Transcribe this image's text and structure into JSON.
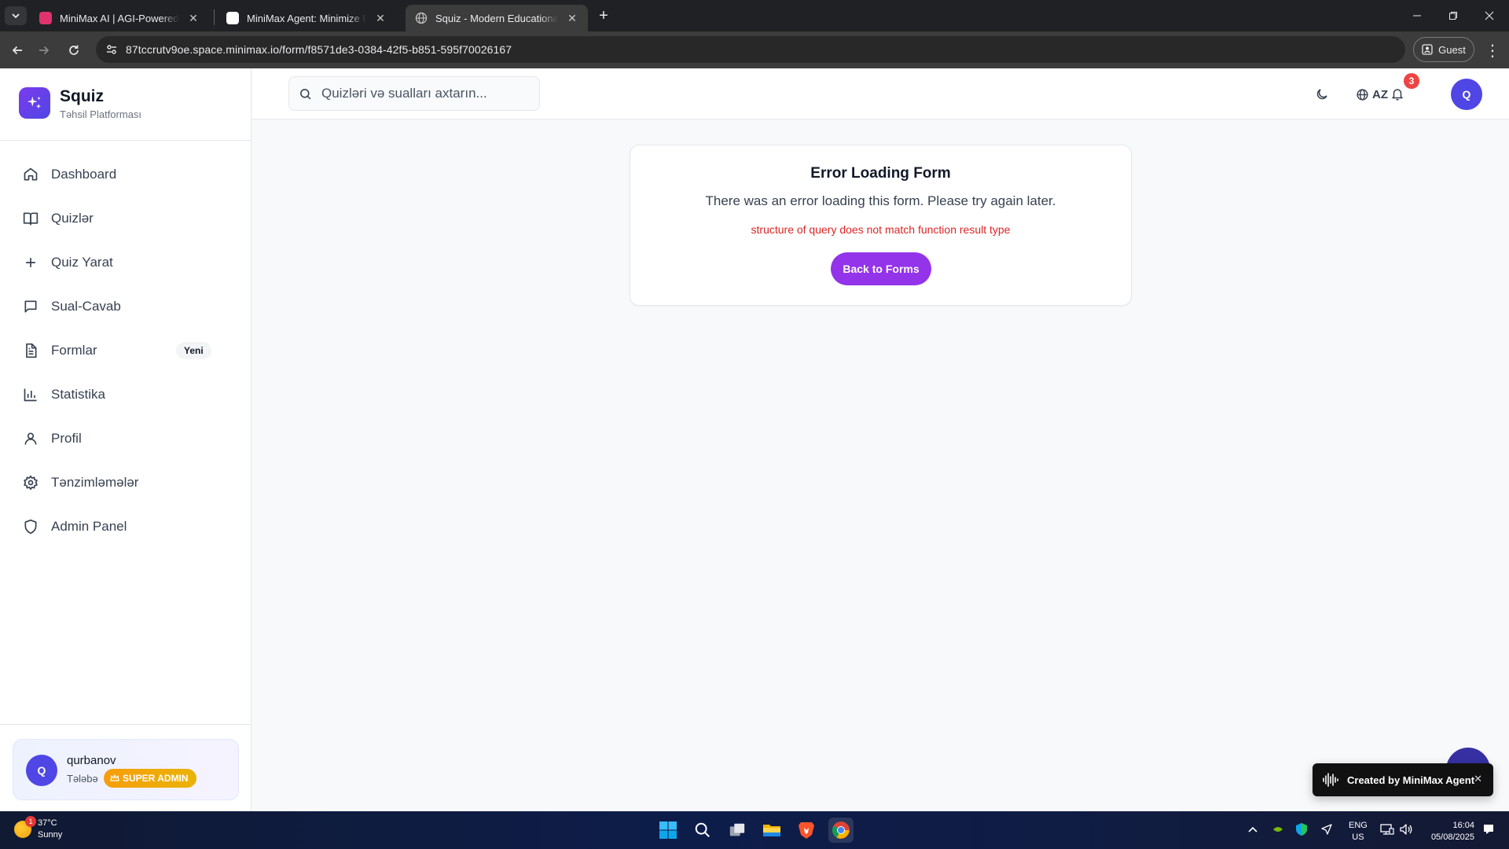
{
  "browser": {
    "tabs": [
      {
        "title": "MiniMax AI | AGI-Powered Fo",
        "active": false
      },
      {
        "title": "MiniMax Agent: Minimize Effort",
        "active": false
      },
      {
        "title": "Squiz - Modern Educational Pla",
        "active": true
      }
    ],
    "url": "87tccrutv9oe.space.minimax.io/form/f8571de3-0384-42f5-b851-595f70026167",
    "profile_label": "Guest"
  },
  "app": {
    "brand": {
      "name": "Squiz",
      "subtitle": "Təhsil Platforması"
    },
    "nav": [
      {
        "label": "Dashboard",
        "icon": "home-icon"
      },
      {
        "label": "Quizlər",
        "icon": "book-icon"
      },
      {
        "label": "Quiz Yarat",
        "icon": "plus-icon"
      },
      {
        "label": "Sual-Cavab",
        "icon": "message-icon"
      },
      {
        "label": "Formlar",
        "icon": "file-text-icon",
        "badge": "Yeni"
      },
      {
        "label": "Statistika",
        "icon": "bar-chart-icon"
      },
      {
        "label": "Profil",
        "icon": "user-icon"
      },
      {
        "label": "Tənzimləmələr",
        "icon": "gear-icon"
      },
      {
        "label": "Admin Panel",
        "icon": "shield-icon"
      }
    ],
    "user": {
      "initial": "Q",
      "name": "qurbanov",
      "role": "Tələbə",
      "badge": "SUPER ADMIN"
    },
    "topbar": {
      "search_placeholder": "Quizləri və sualları axtarın...",
      "language": "AZ",
      "notification_count": "3",
      "avatar_initial": "Q"
    },
    "error": {
      "title": "Error Loading Form",
      "message": "There was an error loading this form. Please try again later.",
      "detail": "structure of query does not match function result type",
      "button": "Back to Forms"
    },
    "toast": {
      "label": "Created by MiniMax Agent"
    },
    "colors": {
      "accent": "#9333ea",
      "brand": "#4f46e5",
      "error": "#dc2626",
      "badge": "#f59e0b"
    }
  },
  "taskbar": {
    "weather": {
      "temp": "37°C",
      "condition": "Sunny",
      "alert_count": "1"
    },
    "language": {
      "line1": "ENG",
      "line2": "US"
    },
    "clock": {
      "time": "16:04",
      "date": "05/08/2025"
    }
  }
}
